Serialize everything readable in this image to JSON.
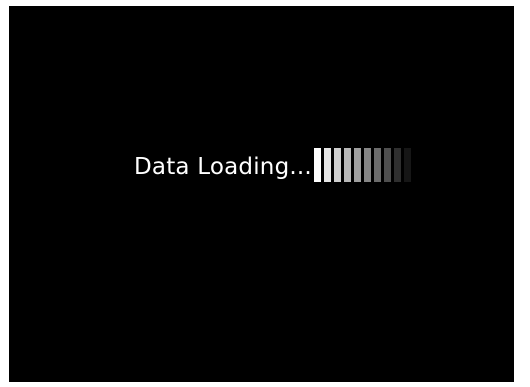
{
  "loading": {
    "text": "Data Loading...",
    "bar_colors": [
      "#ffffff",
      "#e6e6e6",
      "#cfcfcf",
      "#b8b8b8",
      "#9f9f9f",
      "#868686",
      "#6c6c6c",
      "#4f4f4f",
      "#2f2f2f",
      "#161616"
    ]
  },
  "colors": {
    "background": "#000000",
    "text": "#ffffff"
  }
}
